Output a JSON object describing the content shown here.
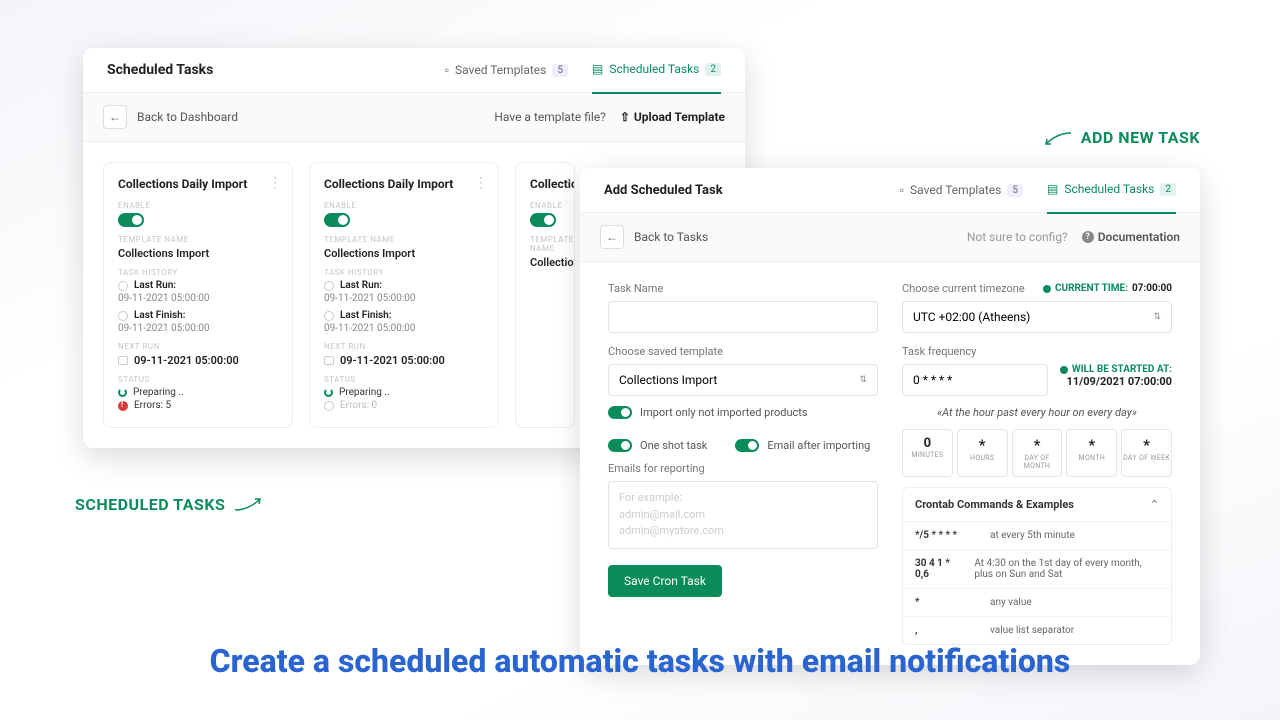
{
  "panel1": {
    "title": "Scheduled Tasks",
    "tabs": {
      "saved": "Saved Templates",
      "saved_count": "5",
      "sched": "Scheduled Tasks",
      "sched_count": "2"
    },
    "back": "Back to Dashboard",
    "have_template": "Have a template file?",
    "upload": "Upload Template",
    "card_title": "Collections Daily Import",
    "lbl_enable": "ENABLE",
    "lbl_template": "TEMPLATE NAME",
    "template_name": "Collections Import",
    "lbl_history": "TASK HISTORY",
    "last_run": "Last Run:",
    "last_run_val": "09-11-2021 05:00:00",
    "last_finish": "Last Finish:",
    "last_finish_val": "09-11-2021 05:00:00",
    "lbl_next": "NEXT RUN",
    "next_run": "09-11-2021 05:00:00",
    "lbl_status": "STATUS",
    "status_prep": "Preparing ..",
    "status_err": "Errors: 5",
    "status_err0": "Errors: 0"
  },
  "panel2": {
    "title": "Add Scheduled Task",
    "tabs": {
      "saved": "Saved Templates",
      "saved_count": "5",
      "sched": "Scheduled Tasks",
      "sched_count": "2"
    },
    "back": "Back to Tasks",
    "not_sure": "Not sure to config?",
    "docs": "Documentation",
    "task_name": "Task Name",
    "choose_template": "Choose saved template",
    "template_sel": "Collections Import",
    "tog_import": "Import only not imported products",
    "tog_oneshot": "One shot task",
    "tog_email": "Email after importing",
    "emails_label": "Emails for reporting",
    "emails_ph": "For example:\nadmin@mail.com\nadmin@mystore.com",
    "save_btn": "Save Cron Task",
    "tz_label": "Choose current timezone",
    "cur_time_lbl": "CURRENT TIME:",
    "cur_time_val": "07:00:00",
    "tz_sel": "UTC +02:00 (Atheens)",
    "freq_label": "Task frequency",
    "freq_val": "0 * * * *",
    "start_lbl": "WILL BE STARTED AT:",
    "start_val": "11/09/2021 07:00:00",
    "hint": "«At the hour past every hour on every day»",
    "cron": {
      "min_v": "0",
      "min_u": "MINUTES",
      "hr_v": "*",
      "hr_u": "HOURS",
      "dom_v": "*",
      "dom_u": "DAY OF MONTH",
      "mon_v": "*",
      "mon_u": "MONTH",
      "dow_v": "*",
      "dow_u": "DAY OF WEEK"
    },
    "acc_title": "Crontab Commands & Examples",
    "examples": [
      {
        "c": "*/5 * * * *",
        "d": "at every 5th minute"
      },
      {
        "c": "30 4 1 * 0,6",
        "d": "At 4:30 on the 1st day of every month, plus on Sun and Sat"
      },
      {
        "c": "*",
        "d": "any value"
      },
      {
        "c": ",",
        "d": "value list separator"
      }
    ]
  },
  "callouts": {
    "scheduled": "SCHEDULED TASKS",
    "addnew": "ADD NEW TASK"
  },
  "headline": "Create a scheduled automatic tasks with email notifications"
}
